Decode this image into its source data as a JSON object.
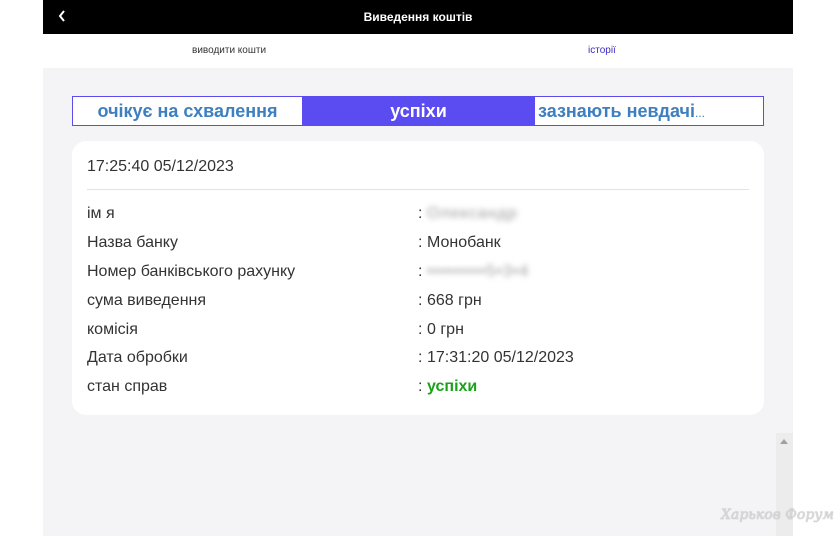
{
  "header": {
    "back_icon": "chevron-left-icon",
    "title": "Виведення коштів"
  },
  "subtabs": {
    "withdraw_label": "виводити кошти",
    "history_label": "історії"
  },
  "status_tabs": {
    "pending_label": "очікує на схвалення",
    "success_label": "успіхи",
    "failed_label": "зазнають невдачі",
    "failed_ellipsis": "..."
  },
  "record": {
    "timestamp": "17:25:40 05/12/2023",
    "fields": [
      {
        "label": "ім я",
        "value": "Олександр"
      },
      {
        "label": "Назва банку",
        "value": "Монобанк"
      },
      {
        "label": "Номер банківського рахунку",
        "value": "•••••••••5•3•4"
      },
      {
        "label": "сума виведення",
        "value": "668 грн"
      },
      {
        "label": "комісія",
        "value": "0 грн"
      },
      {
        "label": "Дата обробки",
        "value": "17:31:20 05/12/2023"
      },
      {
        "label": "стан справ",
        "value": "успіхи"
      }
    ],
    "separator": ":"
  },
  "watermark": "Харьков Форум",
  "colors": {
    "accent": "#5a4cf0",
    "tab_text": "#3d7fc0",
    "success": "#1aa31a",
    "history_link": "#3b2bc6"
  }
}
